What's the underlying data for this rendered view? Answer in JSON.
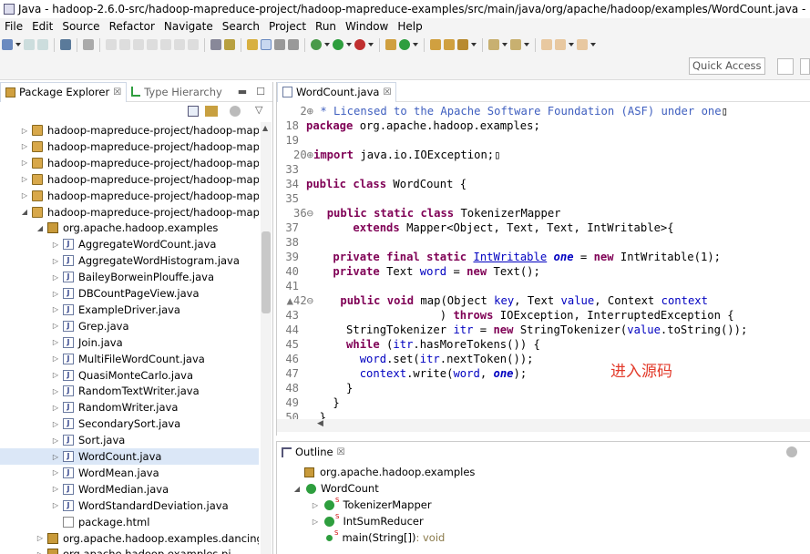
{
  "window": {
    "title": "Java - hadoop-2.6.0-src/hadoop-mapreduce-project/hadoop-mapreduce-examples/src/main/java/org/apache/hadoop/examples/WordCount.java - Eclipse"
  },
  "menu": [
    "File",
    "Edit",
    "Source",
    "Refactor",
    "Navigate",
    "Search",
    "Project",
    "Run",
    "Window",
    "Help"
  ],
  "quick_access": {
    "placeholder": "Quick Access"
  },
  "left_view": {
    "tabs": [
      {
        "label": "Package Explorer",
        "active": true
      },
      {
        "label": "Type Hierarchy",
        "active": false
      }
    ],
    "tree": [
      {
        "label": "hadoop-mapreduce-project/hadoop-mapre",
        "kind": "project",
        "indent": 0
      },
      {
        "label": "hadoop-mapreduce-project/hadoop-mapre",
        "kind": "project",
        "indent": 0
      },
      {
        "label": "hadoop-mapreduce-project/hadoop-mapre",
        "kind": "project",
        "indent": 0
      },
      {
        "label": "hadoop-mapreduce-project/hadoop-mapre",
        "kind": "project",
        "indent": 0
      },
      {
        "label": "hadoop-mapreduce-project/hadoop-mapre",
        "kind": "project",
        "indent": 0
      },
      {
        "label": "hadoop-mapreduce-project/hadoop-mapre",
        "kind": "project",
        "indent": 0,
        "expanded": true
      },
      {
        "label": "org.apache.hadoop.examples",
        "kind": "package",
        "indent": 1,
        "expanded": true
      },
      {
        "label": "AggregateWordCount.java",
        "kind": "java",
        "indent": 2
      },
      {
        "label": "AggregateWordHistogram.java",
        "kind": "java",
        "indent": 2
      },
      {
        "label": "BaileyBorweinPlouffe.java",
        "kind": "java",
        "indent": 2
      },
      {
        "label": "DBCountPageView.java",
        "kind": "java",
        "indent": 2
      },
      {
        "label": "ExampleDriver.java",
        "kind": "java",
        "indent": 2
      },
      {
        "label": "Grep.java",
        "kind": "java",
        "indent": 2
      },
      {
        "label": "Join.java",
        "kind": "java",
        "indent": 2
      },
      {
        "label": "MultiFileWordCount.java",
        "kind": "java",
        "indent": 2
      },
      {
        "label": "QuasiMonteCarlo.java",
        "kind": "java",
        "indent": 2
      },
      {
        "label": "RandomTextWriter.java",
        "kind": "java",
        "indent": 2
      },
      {
        "label": "RandomWriter.java",
        "kind": "java",
        "indent": 2
      },
      {
        "label": "SecondarySort.java",
        "kind": "java",
        "indent": 2
      },
      {
        "label": "Sort.java",
        "kind": "java",
        "indent": 2
      },
      {
        "label": "WordCount.java",
        "kind": "java",
        "indent": 2,
        "selected": true
      },
      {
        "label": "WordMean.java",
        "kind": "java",
        "indent": 2
      },
      {
        "label": "WordMedian.java",
        "kind": "java",
        "indent": 2
      },
      {
        "label": "WordStandardDeviation.java",
        "kind": "java",
        "indent": 2
      },
      {
        "label": "package.html",
        "kind": "html",
        "indent": 2,
        "noarrow": true
      },
      {
        "label": "org.apache.hadoop.examples.dancing",
        "kind": "package",
        "indent": 1
      },
      {
        "label": "org.apache.hadoop.examples.pi",
        "kind": "package",
        "indent": 1
      }
    ]
  },
  "editor": {
    "tab": "WordCount.java",
    "lines": [
      {
        "n": "2",
        "fold": "⊕",
        "parts": [
          [
            " * Licensed to the Apache Software Foundation (ASF) under one",
            "cm"
          ],
          [
            "▯",
            ""
          ]
        ]
      },
      {
        "n": "18",
        "parts": [
          [
            "package",
            "kw"
          ],
          [
            " org.apache.hadoop.examples;",
            ""
          ]
        ]
      },
      {
        "n": "19",
        "parts": []
      },
      {
        "n": "20",
        "fold": "⊕",
        "parts": [
          [
            "import",
            "kw"
          ],
          [
            " java.io.IOException;▯",
            ""
          ]
        ]
      },
      {
        "n": "33",
        "parts": []
      },
      {
        "n": "34",
        "parts": [
          [
            "public",
            "kw"
          ],
          [
            " ",
            ""
          ],
          [
            "class",
            "kw"
          ],
          [
            " WordCount {",
            ""
          ]
        ]
      },
      {
        "n": "35",
        "parts": []
      },
      {
        "n": "36",
        "fold": "⊖",
        "parts": [
          [
            "  ",
            ""
          ],
          [
            "public",
            "kw"
          ],
          [
            " ",
            ""
          ],
          [
            "static",
            "kw"
          ],
          [
            " ",
            ""
          ],
          [
            "class",
            "kw"
          ],
          [
            " TokenizerMapper",
            ""
          ]
        ]
      },
      {
        "n": "37",
        "parts": [
          [
            "       ",
            ""
          ],
          [
            "extends",
            "kw"
          ],
          [
            " Mapper<Object, Text, Text, IntWritable>{",
            ""
          ]
        ]
      },
      {
        "n": "38",
        "parts": []
      },
      {
        "n": "39",
        "parts": [
          [
            "    ",
            ""
          ],
          [
            "private",
            "kw"
          ],
          [
            " ",
            ""
          ],
          [
            "final",
            "kw"
          ],
          [
            " ",
            ""
          ],
          [
            "static",
            "kw"
          ],
          [
            " ",
            ""
          ],
          [
            "IntWritable",
            "typ"
          ],
          [
            " ",
            ""
          ],
          [
            "one",
            "fldi"
          ],
          [
            " = ",
            ""
          ],
          [
            "new",
            "kw"
          ],
          [
            " IntWritable(1);",
            ""
          ]
        ]
      },
      {
        "n": "40",
        "parts": [
          [
            "    ",
            ""
          ],
          [
            "private",
            "kw"
          ],
          [
            " Text ",
            ""
          ],
          [
            "word",
            "fld"
          ],
          [
            " = ",
            ""
          ],
          [
            "new",
            "kw"
          ],
          [
            " Text();",
            ""
          ]
        ]
      },
      {
        "n": "41",
        "parts": []
      },
      {
        "n": "42",
        "fold": "⊖",
        "marker": "▲",
        "parts": [
          [
            "    ",
            ""
          ],
          [
            "public",
            "kw"
          ],
          [
            " ",
            ""
          ],
          [
            "void",
            "kw"
          ],
          [
            " map(Object ",
            ""
          ],
          [
            "key",
            "fld"
          ],
          [
            ", Text ",
            ""
          ],
          [
            "value",
            "fld"
          ],
          [
            ", Context ",
            ""
          ],
          [
            "context",
            "fld"
          ]
        ]
      },
      {
        "n": "43",
        "parts": [
          [
            "                    ) ",
            ""
          ],
          [
            "throws",
            "kw"
          ],
          [
            " IOException, InterruptedException {",
            ""
          ]
        ]
      },
      {
        "n": "44",
        "parts": [
          [
            "      StringTokenizer ",
            ""
          ],
          [
            "itr",
            "fld"
          ],
          [
            " = ",
            ""
          ],
          [
            "new",
            "kw"
          ],
          [
            " StringTokenizer(",
            ""
          ],
          [
            "value",
            "fld"
          ],
          [
            ".toString());",
            ""
          ]
        ]
      },
      {
        "n": "45",
        "parts": [
          [
            "      ",
            ""
          ],
          [
            "while",
            "kw"
          ],
          [
            " (",
            ""
          ],
          [
            "itr",
            "fld"
          ],
          [
            ".hasMoreTokens()) {",
            ""
          ]
        ]
      },
      {
        "n": "46",
        "parts": [
          [
            "        ",
            ""
          ],
          [
            "word",
            "fld"
          ],
          [
            ".set(",
            ""
          ],
          [
            "itr",
            "fld"
          ],
          [
            ".nextToken());",
            ""
          ]
        ]
      },
      {
        "n": "47",
        "parts": [
          [
            "        ",
            ""
          ],
          [
            "context",
            "fld"
          ],
          [
            ".write(",
            ""
          ],
          [
            "word",
            "fld"
          ],
          [
            ", ",
            ""
          ],
          [
            "one",
            "fldi"
          ],
          [
            ");",
            ""
          ]
        ]
      },
      {
        "n": "48",
        "parts": [
          [
            "      }",
            ""
          ]
        ]
      },
      {
        "n": "49",
        "parts": [
          [
            "    }",
            ""
          ]
        ]
      },
      {
        "n": "50",
        "parts": [
          [
            "  }",
            ""
          ]
        ]
      }
    ],
    "annotation": "进入源码"
  },
  "outline": {
    "tab": "Outline",
    "items": [
      {
        "label": "org.apache.hadoop.examples",
        "kind": "package",
        "indent": 0
      },
      {
        "label": "WordCount",
        "kind": "class",
        "indent": 0,
        "expanded": true
      },
      {
        "label": "TokenizerMapper",
        "kind": "inner",
        "indent": 1
      },
      {
        "label": "IntSumReducer",
        "kind": "inner",
        "indent": 1
      },
      {
        "label": "main(String[])",
        "type": " : void",
        "kind": "method",
        "indent": 1
      }
    ]
  },
  "colors": {
    "keyword": "#7f0055",
    "comment": "#3f5fbf",
    "field": "#0000c0",
    "annotation": "#e23a2a",
    "selection": "#dbe7f7"
  }
}
